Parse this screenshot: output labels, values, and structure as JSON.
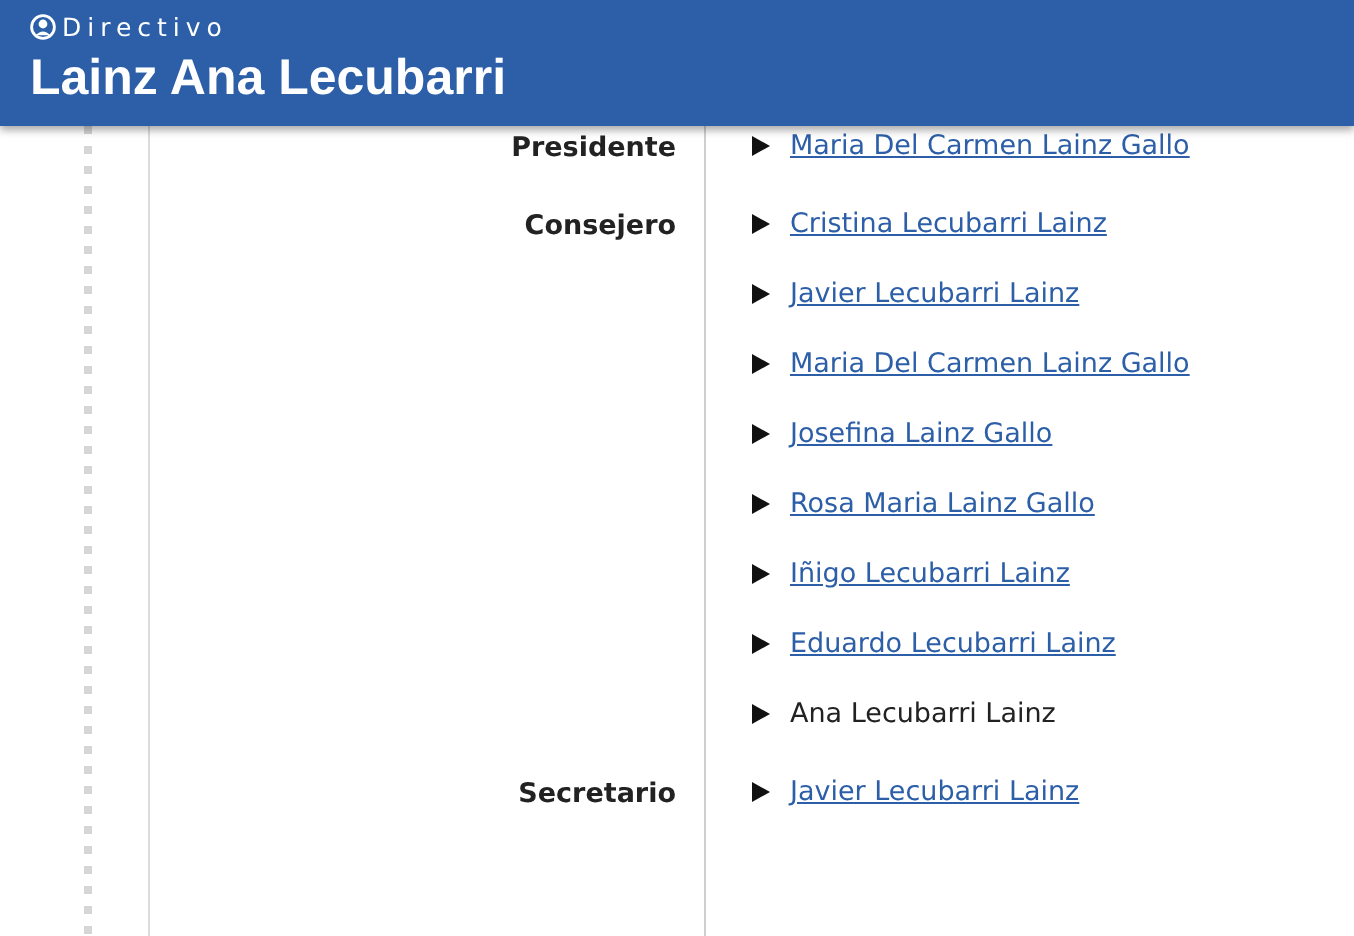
{
  "header": {
    "section": "Directivo",
    "title": "Lainz Ana Lecubarri"
  },
  "groups": [
    {
      "role": "Presidente",
      "members": [
        {
          "name": "Maria Del Carmen Lainz Gallo",
          "link": true
        }
      ]
    },
    {
      "role": "Consejero",
      "members": [
        {
          "name": "Cristina Lecubarri Lainz",
          "link": true
        },
        {
          "name": "Javier Lecubarri Lainz",
          "link": true
        },
        {
          "name": "Maria Del Carmen Lainz Gallo",
          "link": true
        },
        {
          "name": "Josefina Lainz Gallo",
          "link": true
        },
        {
          "name": "Rosa Maria Lainz Gallo",
          "link": true
        },
        {
          "name": "Iñigo Lecubarri Lainz",
          "link": true
        },
        {
          "name": "Eduardo Lecubarri Lainz",
          "link": true
        },
        {
          "name": "Ana Lecubarri Lainz",
          "link": false
        }
      ]
    },
    {
      "role": "Secretario",
      "members": [
        {
          "name": "Javier Lecubarri Lainz",
          "link": true
        }
      ]
    }
  ]
}
